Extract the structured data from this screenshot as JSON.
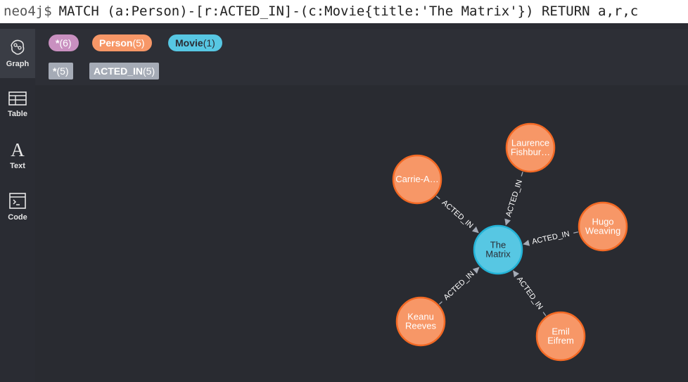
{
  "query_bar": {
    "prompt": "neo4j$",
    "query": "MATCH (a:Person)-[r:ACTED_IN]-(c:Movie{title:'The Matrix'}) RETURN a,r,c"
  },
  "sidebar": {
    "items": [
      {
        "label": "Graph",
        "icon": "graph-icon",
        "active": true
      },
      {
        "label": "Table",
        "icon": "table-icon",
        "active": false
      },
      {
        "label": "Text",
        "icon": "text-icon",
        "active": false
      },
      {
        "label": "Code",
        "icon": "code-icon",
        "active": false
      }
    ]
  },
  "legend": {
    "node_labels": [
      {
        "name": "*",
        "count": "(6)",
        "color": "#c990c0"
      },
      {
        "name": "Person",
        "count": "(5)",
        "color": "#f79767"
      },
      {
        "name": "Movie",
        "count": "(1)",
        "color": "#57c7e3"
      }
    ],
    "relationship_types": [
      {
        "name": "*",
        "count": "(5)",
        "color": "#a5abb6"
      },
      {
        "name": "ACTED_IN",
        "count": "(5)",
        "color": "#a5abb6"
      }
    ]
  },
  "graph": {
    "colors": {
      "person_fill": "#f79767",
      "person_stroke": "#f36924",
      "movie_fill": "#57c7e3",
      "movie_stroke": "#23b3d7",
      "edge": "#a5abb6",
      "person_text": "#ffffff",
      "movie_text": "#2a2c34"
    },
    "center_node": {
      "id": "matrix",
      "lines": [
        "The",
        "Matrix"
      ],
      "label": "Movie"
    },
    "person_nodes": [
      {
        "id": "carrie",
        "lines": [
          "Carrie-A…"
        ],
        "rel": "ACTED_IN"
      },
      {
        "id": "laurence",
        "lines": [
          "Laurence",
          "Fishbur…"
        ],
        "rel": "ACTED_IN"
      },
      {
        "id": "hugo",
        "lines": [
          "Hugo",
          "Weaving"
        ],
        "rel": "ACTED_IN"
      },
      {
        "id": "keanu",
        "lines": [
          "Keanu",
          "Reeves"
        ],
        "rel": "ACTED_IN"
      },
      {
        "id": "emil",
        "lines": [
          "Emil",
          "Eifrem"
        ],
        "rel": "ACTED_IN"
      }
    ]
  }
}
